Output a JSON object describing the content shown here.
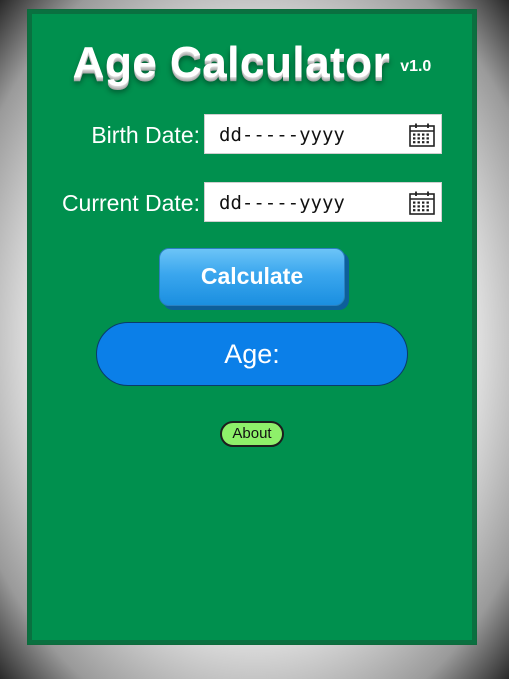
{
  "app": {
    "title": "Age Calculator",
    "version": "v1.0"
  },
  "fields": {
    "birth_date": {
      "label": "Birth Date:",
      "value": "dd-----yyyy",
      "icon": "calendar-icon"
    },
    "current_date": {
      "label": "Current Date:",
      "value": "dd-----yyyy",
      "icon": "calendar-icon"
    }
  },
  "actions": {
    "calculate_label": "Calculate",
    "about_label": "About"
  },
  "result": {
    "label": "Age:"
  },
  "colors": {
    "panel_bg": "#00904e",
    "panel_border": "#0a7040",
    "button_blue": "#1b8fe0",
    "result_blue": "#0b7fe8",
    "about_green": "#8ef06a"
  }
}
